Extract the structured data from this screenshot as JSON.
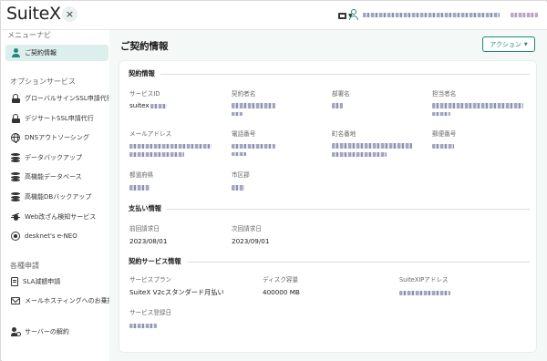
{
  "app": {
    "logo": "SuiteX",
    "collapse_icon": "×"
  },
  "header": {
    "org_icon": "building-icon",
    "user_icon": "user-icon"
  },
  "sidebar": {
    "menu_title": "メニューナビ",
    "active_item": "ご契約情報",
    "options_title": "オプションサービス",
    "items": [
      {
        "label": "グローバルサインSSL申請代行",
        "icon": "lock-icon"
      },
      {
        "label": "デジサートSSL申請代行",
        "icon": "lock-icon"
      },
      {
        "label": "DNSアウトソーシング",
        "icon": "globe-icon"
      },
      {
        "label": "データバックアップ",
        "icon": "database-icon"
      },
      {
        "label": "高機能データベース",
        "icon": "database-icon"
      },
      {
        "label": "高機能DBバックアップ",
        "icon": "database-icon"
      },
      {
        "label": "Web改ざん検知サービス",
        "icon": "bug-icon"
      },
      {
        "label": "desknet's e-NEO",
        "icon": "neo-icon"
      }
    ],
    "requests_title": "各種申請",
    "requests": [
      {
        "label": "SLA減額申請",
        "icon": "document-icon"
      },
      {
        "label": "メールホスティングへのお乗換",
        "icon": "mail-icon"
      }
    ],
    "cancel_label": "サーバーの解約"
  },
  "main": {
    "page_title": "ご契約情報",
    "action_button": "アクション",
    "contract": {
      "heading": "契約情報",
      "service_id_label": "サービスID",
      "service_id_value": "suitex",
      "contractor_label": "契約者名",
      "department_label": "部署名",
      "person_label": "担当者名",
      "email_label": "メールアドレス",
      "phone_label": "電話番号",
      "town_label": "町名番地",
      "postal_label": "郵便番号",
      "prefecture_label": "都道府県",
      "city_label": "市区郡"
    },
    "payment": {
      "heading": "支払い情報",
      "prev_label": "前回請求日",
      "prev_value": "2023/08/01",
      "next_label": "次回請求日",
      "next_value": "2023/09/01"
    },
    "service": {
      "heading": "契約サービス情報",
      "plan_label": "サービスプラン",
      "plan_value": "SuiteX V2cスタンダード月払い",
      "disk_label": "ディスク容量",
      "disk_value": "400000 MB",
      "ip_label": "SuiteXIPアドレス",
      "registered_label": "サービス登録日"
    }
  },
  "colors": {
    "accent": "#1d8a79",
    "active_bg": "#dcefec",
    "main_bg": "#f4f8f7"
  }
}
